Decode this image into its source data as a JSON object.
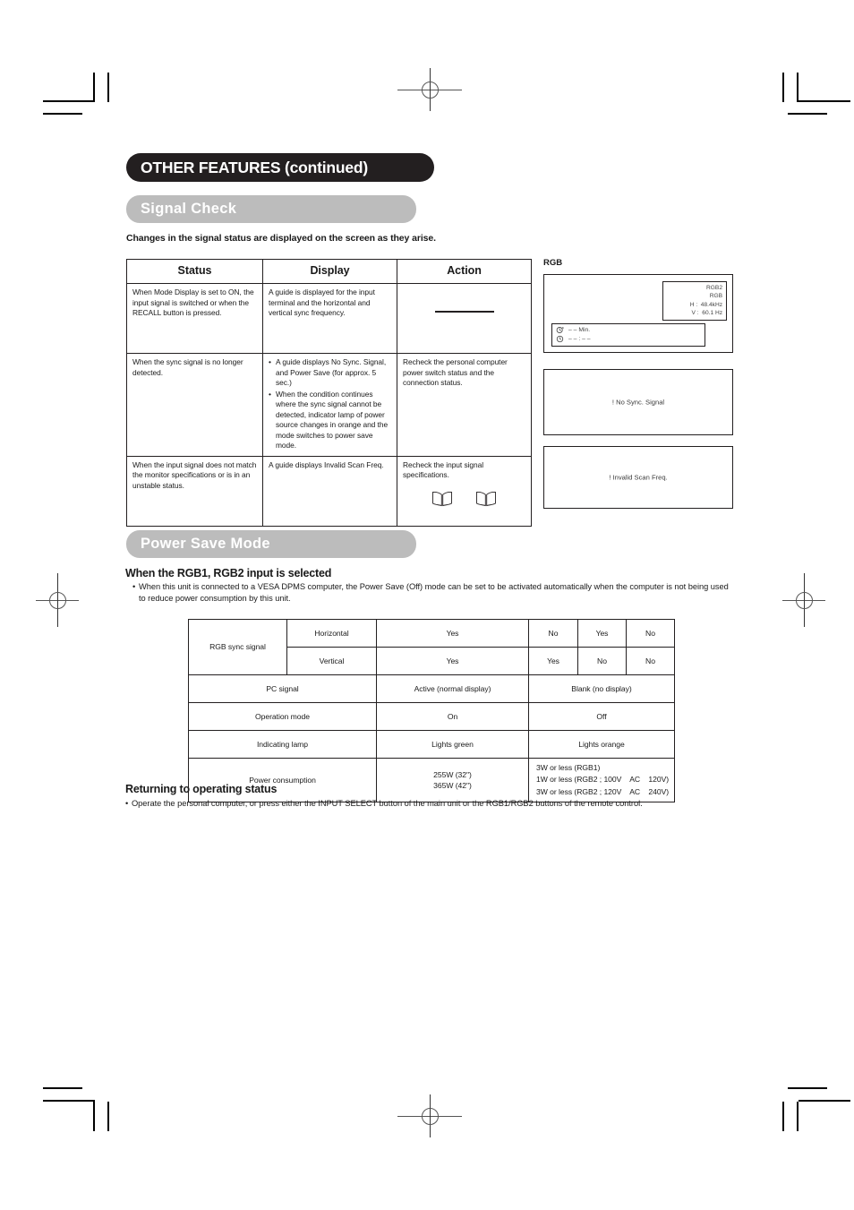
{
  "page": {
    "chapter_title": "OTHER FEATURES (continued)",
    "sections": [
      {
        "id": "signal_check",
        "label": "Signal Check"
      },
      {
        "id": "power_save",
        "label": "Power Save Mode"
      }
    ],
    "lead_line": "Changes in the signal status are displayed on the screen as they arise."
  },
  "signal_table": {
    "headers": [
      "Status",
      "Display",
      "Action"
    ],
    "rows": [
      {
        "status": "When Mode Display is set to ON, the input signal is switched or when the RECALL button is pressed.",
        "display_text": "A guide is displayed for the input terminal and the horizontal and vertical sync frequency.",
        "display_bullets": [],
        "action_text": "",
        "action_mark": "horizontal-rule"
      },
      {
        "status": "When the sync signal is no longer detected.",
        "display_text": "",
        "display_bullets": [
          "A guide displays No Sync. Signal, and Power Save (for approx. 5 sec.)",
          "When the condition continues where the sync signal cannot be detected, indicator lamp of power source changes in orange and the mode switches to power save mode."
        ],
        "action_text": "Recheck the personal computer power switch status and the connection status.",
        "action_mark": ""
      },
      {
        "status": "When the input signal does not match the monitor specifications or is in an unstable status.",
        "display_text": "A guide displays Invalid Scan Freq.",
        "display_bullets": [],
        "action_text": "Recheck the input signal specifications.",
        "action_mark": "book-icons"
      }
    ]
  },
  "osd": {
    "rgb_label": "RGB",
    "rgb_panel": {
      "line1": "RGB2",
      "line2": "RGB",
      "line3": "H :  48.4kHz",
      "line4": "V :  60.1 Hz",
      "timer_lamp": "– –  Min.",
      "timer_clock": "– – : – –"
    },
    "no_sync_message": "! No Sync. Signal",
    "invalid_message": "! Invalid Scan Freq."
  },
  "power_save": {
    "sub_head": "When the RGB1, RGB2 input is selected",
    "intro_bullet": "When this unit is connected to a VESA DPMS computer, the Power Save (Off) mode can be set to be activated automatically when the computer is not being used to reduce power consumption by this unit.",
    "table": {
      "row_sync_label": "RGB sync signal",
      "row_horizontal_label": "Horizontal",
      "row_vertical_label": "Vertical",
      "horizontal_values": [
        "Yes",
        "No",
        "Yes",
        "No"
      ],
      "vertical_values": [
        "Yes",
        "Yes",
        "No",
        "No"
      ],
      "pc_signal_label": "PC signal",
      "pc_signal_active": "Active (normal display)",
      "pc_signal_blank": "Blank (no display)",
      "operation_mode_label": "Operation mode",
      "operation_mode_on": "On",
      "operation_mode_off": "Off",
      "indicating_lamp_label": "Indicating lamp",
      "indicating_lamp_green": "Lights green",
      "indicating_lamp_orange": "Lights orange",
      "power_consumption_label": "Power consumption",
      "power_consumption_on_line1": "255W (32\")",
      "power_consumption_on_line2": "365W (42\")",
      "power_consumption_off_line1": "3W or less (RGB1)",
      "power_consumption_off_line2": "1W or less (RGB2 ; 100V    AC    120V)",
      "power_consumption_off_line3": "3W or less (RGB2 ; 120V    AC    240V)"
    },
    "returning_head": "Returning to operating status",
    "returning_bullet": "Operate the personal computer, or press either the INPUT SELECT button of the main unit or the RGB1/RGB2 buttons of the remote control."
  },
  "colors": {
    "chapter_bg": "#231f20",
    "section_bg": "#bcbcbc",
    "text": "#1a1a1a",
    "rule": "#231f20"
  }
}
